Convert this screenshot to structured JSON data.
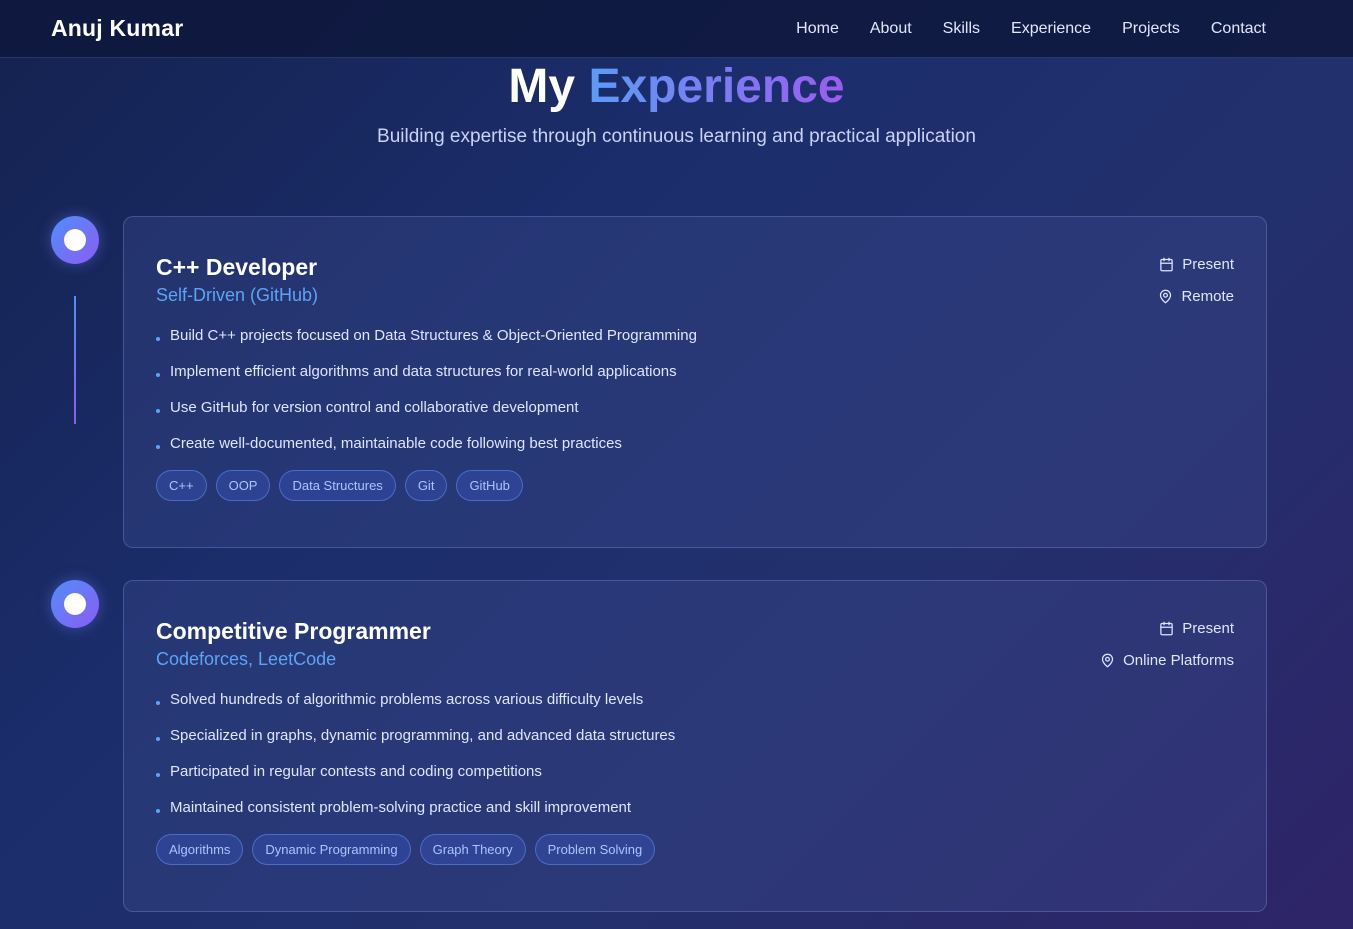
{
  "nav": {
    "brand": "Anuj Kumar",
    "links": [
      "Home",
      "About",
      "Skills",
      "Experience",
      "Projects",
      "Contact"
    ]
  },
  "hero": {
    "title_plain": "My",
    "title_accent": "Experience",
    "subtitle": "Building expertise through continuous learning and practical application"
  },
  "experiences": [
    {
      "title": "C++ Developer",
      "org": "Self-Driven (GitHub)",
      "date": "Present",
      "location": "Remote",
      "bullets": [
        "Build C++ projects focused on Data Structures & Object-Oriented Programming",
        "Implement efficient algorithms and data structures for real-world applications",
        "Use GitHub for version control and collaborative development",
        "Create well-documented, maintainable code following best practices"
      ],
      "tags": [
        "C++",
        "OOP",
        "Data Structures",
        "Git",
        "GitHub"
      ]
    },
    {
      "title": "Competitive Programmer",
      "org": "Codeforces, LeetCode",
      "date": "Present",
      "location": "Online Platforms",
      "bullets": [
        "Solved hundreds of algorithmic problems across various difficulty levels",
        "Specialized in graphs, dynamic programming, and advanced data structures",
        "Participated in regular contests and coding competitions",
        "Maintained consistent problem-solving practice and skill improvement"
      ],
      "tags": [
        "Algorithms",
        "Dynamic Programming",
        "Graph Theory",
        "Problem Solving"
      ]
    }
  ],
  "icons": {
    "date": "calendar-icon",
    "location": "map-pin-icon"
  },
  "colors": {
    "accent_blue": "#5ea3f5",
    "accent_purple": "#8b5cf6",
    "tag_text": "#a9c5ff"
  }
}
